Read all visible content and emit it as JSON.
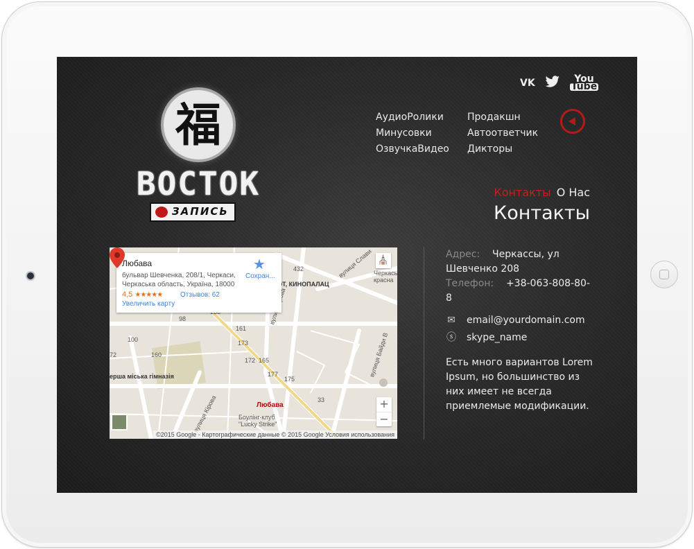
{
  "social": {
    "vk": "VK",
    "twitter": "twitter-icon",
    "youtube_top": "You",
    "youtube_bottom": "Tube"
  },
  "logo": {
    "glyph": "福",
    "word": "BOCTOK",
    "badge_text": "ЗАПИСЬ"
  },
  "nav": {
    "col1": [
      "АудиоРолики",
      "Минусовки",
      "ОзвучкаВидео"
    ],
    "col2": [
      "Продакшн",
      "Автоответчик",
      "Дикторы"
    ]
  },
  "breadcrumb": {
    "active": "Контакты",
    "link": "О Нас"
  },
  "page_title": "Контакты",
  "map": {
    "place_name": "Любава",
    "address": "бульвар Шевченка, 208/1, Черкаси, Черкаська область, Україна, 18000",
    "rating": "4,5",
    "stars": "★★★★★",
    "reviews": "Отзывов: 62",
    "enlarge": "Увеличить карту",
    "save": "Сохран...",
    "pin_label": "Любава",
    "labels": {
      "kinopalats": "ЮТ, КИНОПАЛАЦ",
      "gymnasium": "ерша міська гімназія",
      "street_slavy": "вулиця Слави",
      "street_baidy": "вулиця Байди В",
      "street_kyrova": "вулиця Кірова",
      "street_grova": "вулиця грова",
      "cherkasy_krasna": "Черкаська красна",
      "bowling": "Боулінг-клуб",
      "lucky_strike": "\"Lucky Strike\"",
      "n432": "432",
      "n192": "192",
      "n133": "133",
      "n161": "161",
      "n173": "173",
      "n165": "165",
      "n177": "177",
      "n175": "175",
      "n172": "172",
      "n160": "160",
      "n98": "98",
      "n100": "100",
      "n72": "72",
      "n33": "33"
    },
    "attribution": "©2015 Google - Картографические данные © 2015 Google   Условия использования",
    "zoom_in": "+",
    "zoom_out": "−"
  },
  "contact": {
    "address_label": "Адрес:",
    "address_value": "Черкассы, ул Шевченко 208",
    "phone_label": "Телефон:",
    "phone_value": "+38-063-808-80-8",
    "email": "email@yourdomain.com",
    "skype": "skype_name",
    "description": "Есть много вариантов Lorem Ipsum, но большинство из них имеет не всегда приемлемые модификации."
  },
  "colors": {
    "accent": "#c81d1d",
    "background": "#2b2b2b"
  }
}
